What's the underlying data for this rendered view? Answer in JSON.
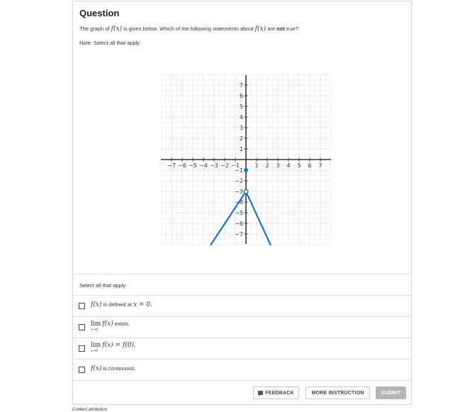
{
  "question": {
    "title": "Question",
    "text_prefix": "The graph of ",
    "fx": "f(x)",
    "text_middle": " is given below. Which of the following statements about ",
    "text_are": " are ",
    "text_not": "not",
    "text_end": " true?",
    "note": "Note: Select all that apply"
  },
  "graph": {
    "x_tick_labels": [
      "−7",
      "−6",
      "−5",
      "−4",
      "−3",
      "−2",
      "−1",
      "1",
      "2",
      "3",
      "4",
      "5",
      "6",
      "7"
    ],
    "y_tick_labels": [
      "7",
      "6",
      "5",
      "4",
      "3",
      "2",
      "1",
      "−1",
      "−2",
      "−3",
      "−4",
      "−5",
      "−6",
      "−7"
    ],
    "line_color": "#1f72c4",
    "filled_point": {
      "x": 0,
      "y": -1
    },
    "open_point": {
      "x": 0,
      "y": -3
    },
    "segments": [
      {
        "from": {
          "x": -3.3,
          "y": -8
        },
        "to": {
          "x": 0,
          "y": -3
        }
      },
      {
        "from": {
          "x": 0,
          "y": -3
        },
        "to": {
          "x": 2.3,
          "y": -8
        }
      }
    ]
  },
  "options": {
    "header": "Select all that apply:",
    "opt1": {
      "math": "f(x)",
      "text": " is defined at ",
      "math2": "x = 0."
    },
    "opt2": {
      "lim": "lim",
      "sub": "x→0",
      "math": "f(x)",
      "text": " exists."
    },
    "opt3": {
      "lim": "lim",
      "sub": "x→0",
      "math": "f(x) = f(0)."
    },
    "opt4": {
      "math": "f(x)",
      "text": " is continuous."
    }
  },
  "buttons": {
    "feedback": "FEEDBACK",
    "more_instruction": "MORE INSTRUCTION",
    "submit": "SUBMIT"
  },
  "footer": {
    "attribution": "Content attribution"
  }
}
